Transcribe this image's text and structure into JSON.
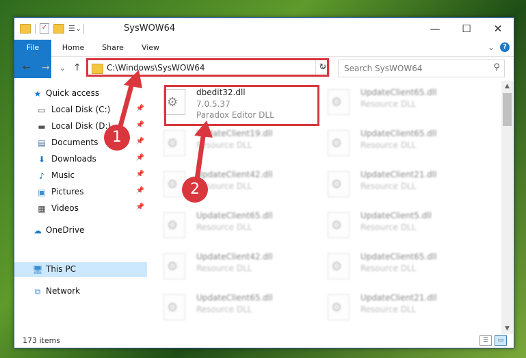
{
  "window": {
    "title": "SysWOW64"
  },
  "titlebar": {
    "minimize": "—",
    "maximize": "☐",
    "close": "✕"
  },
  "ribbon": {
    "tabs": [
      "File",
      "Home",
      "Share",
      "View"
    ],
    "collapse": "⌄",
    "help": "?"
  },
  "navigation": {
    "back": "←",
    "forward": "→",
    "recent": "⌄",
    "up": "↑",
    "address_path": "C:\\Windows\\SysWOW64",
    "address_dropdown": "⌄",
    "refresh": "↻",
    "search_placeholder": "Search SysWOW64"
  },
  "sidebar": {
    "items": [
      {
        "label": "Quick access",
        "icon": "star-icon",
        "pinned": false
      },
      {
        "label": "Local Disk (C:)",
        "icon": "drive-icon",
        "pinned": true
      },
      {
        "label": "Local Disk (D:)",
        "icon": "drive-icon",
        "pinned": true
      },
      {
        "label": "Documents",
        "icon": "documents-icon",
        "pinned": true
      },
      {
        "label": "Downloads",
        "icon": "download-icon",
        "pinned": true
      },
      {
        "label": "Music",
        "icon": "music-icon",
        "pinned": true
      },
      {
        "label": "Pictures",
        "icon": "pictures-icon",
        "pinned": true
      },
      {
        "label": "Videos",
        "icon": "videos-icon",
        "pinned": true
      },
      {
        "label": "OneDrive",
        "icon": "cloud-icon",
        "pinned": false
      },
      {
        "label": "This PC",
        "icon": "computer-icon",
        "pinned": false,
        "selected": true
      },
      {
        "label": "Network",
        "icon": "network-icon",
        "pinned": false
      }
    ]
  },
  "files": [
    {
      "name": "dbedit32.dll",
      "line1": "7.0.5.37",
      "line2": "Paradox Editor DLL",
      "highlighted": true
    },
    {
      "name": "UpdateClient65.dll",
      "line1": "Resource DLL",
      "line2": ""
    },
    {
      "name": "UpdateClient19.dll",
      "line1": "Resource DLL",
      "line2": ""
    },
    {
      "name": "UpdateClient65.dll",
      "line1": "Resource DLL",
      "line2": ""
    },
    {
      "name": "UpdateClient42.dll",
      "line1": "Resource DLL",
      "line2": ""
    },
    {
      "name": "UpdateClient21.dll",
      "line1": "Resource DLL",
      "line2": ""
    },
    {
      "name": "UpdateClient65.dll",
      "line1": "Resource DLL",
      "line2": ""
    },
    {
      "name": "UpdateClient5.dll",
      "line1": "Resource DLL",
      "line2": ""
    },
    {
      "name": "UpdateClient42.dll",
      "line1": "Resource DLL",
      "line2": ""
    },
    {
      "name": "UpdateClient65.dll",
      "line1": "Resource DLL",
      "line2": ""
    },
    {
      "name": "UpdateClient65.dll",
      "line1": "Resource DLL",
      "line2": ""
    },
    {
      "name": "UpdateClient21.dll",
      "line1": "Resource DLL",
      "line2": ""
    }
  ],
  "status": {
    "item_count": "173 items"
  },
  "annotations": {
    "badge1": "1",
    "badge2": "2",
    "color": "#d9363e"
  }
}
